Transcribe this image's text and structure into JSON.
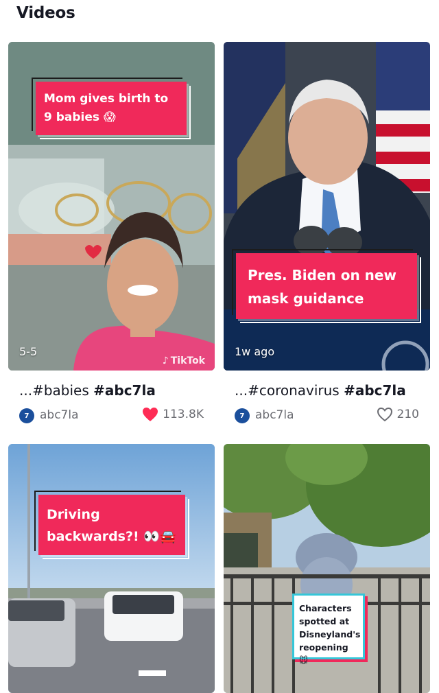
{
  "section": {
    "title": "Videos"
  },
  "videos": [
    {
      "overlay_text": "Mom gives birth to 9 babies",
      "overlay_emoji": "😱",
      "bottom_label": "5-5",
      "watermark": "TikTok",
      "caption_prefix": "...#babies ",
      "caption_hashtag": "#abc7la",
      "author": "abc7la",
      "avatar_text": "7",
      "likes": "113.8K",
      "liked": true
    },
    {
      "overlay_text": "Pres. Biden on new mask guidance",
      "overlay_emoji": "",
      "bottom_label": "1w ago",
      "caption_prefix": "...#coronavirus ",
      "caption_hashtag": "#abc7la",
      "author": "abc7la",
      "avatar_text": "7",
      "likes": "210",
      "liked": false
    },
    {
      "overlay_text": "Driving backwards?!",
      "overlay_emoji": "👀🚘"
    },
    {
      "overlay_text": "Characters spotted at Disneyland's reopening",
      "overlay_emoji": "🐭"
    }
  ],
  "colors": {
    "accent": "#fe2c55",
    "pink_box": "#f0295a",
    "muted_text": "#6b6c72"
  }
}
